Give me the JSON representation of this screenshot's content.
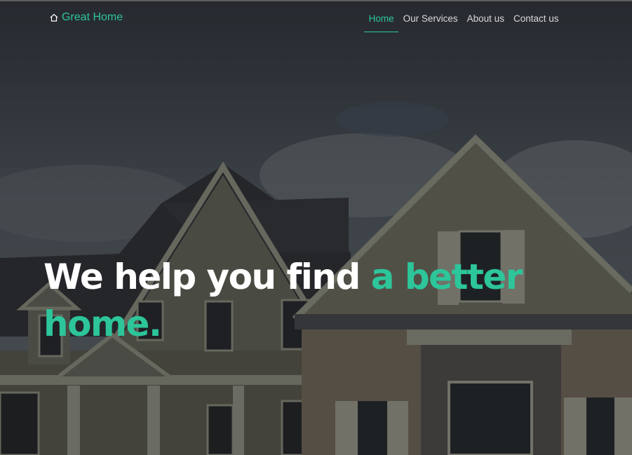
{
  "brand": {
    "icon": "home-icon",
    "label": "Great Home"
  },
  "nav": {
    "items": [
      {
        "label": "Home",
        "active": true
      },
      {
        "label": "Our Services",
        "active": false
      },
      {
        "label": "About us",
        "active": false
      },
      {
        "label": "Contact us",
        "active": false
      }
    ]
  },
  "hero": {
    "headline_part1": "We help you find",
    "headline_accent": "a better home."
  },
  "colors": {
    "accent": "#2dc59a",
    "text": "#ffffff",
    "nav_text": "#d8d8d8"
  }
}
